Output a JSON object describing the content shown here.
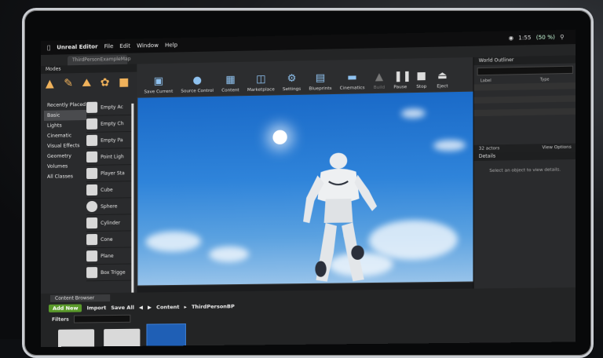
{
  "menubar": {
    "app": "Unreal Editor",
    "items": [
      "File",
      "Edit",
      "Window",
      "Help"
    ],
    "time": "1:55",
    "battery": "(50 %)"
  },
  "tab": {
    "label": "ThirdPersonExampleMap"
  },
  "modes": {
    "title": "Modes",
    "icons": [
      "place-icon",
      "paint-icon",
      "landscape-icon",
      "foliage-icon",
      "geometry-icon"
    ],
    "categories": [
      "Recently Placed",
      "Basic",
      "Lights",
      "Cinematic",
      "Visual Effects",
      "Geometry",
      "Volumes",
      "All Classes"
    ],
    "active_category": "Basic",
    "items": [
      "Empty Ac",
      "Empty Ch",
      "Empty Pa",
      "Point Ligh",
      "Player Sta",
      "Cube",
      "Sphere",
      "Cylinder",
      "Cone",
      "Plane",
      "Box Trigge"
    ]
  },
  "toolbar": {
    "buttons": [
      {
        "label": "Save Current",
        "icon": "save-icon"
      },
      {
        "label": "Source Control",
        "icon": "source-control-icon"
      },
      {
        "label": "Content",
        "icon": "content-icon"
      },
      {
        "label": "Marketplace",
        "icon": "marketplace-icon"
      },
      {
        "label": "Settings",
        "icon": "settings-icon"
      },
      {
        "label": "Blueprints",
        "icon": "blueprints-icon"
      },
      {
        "label": "Cinematics",
        "icon": "cinematics-icon"
      },
      {
        "label": "Build",
        "icon": "build-icon"
      },
      {
        "label": "Pause",
        "icon": "pause-icon"
      },
      {
        "label": "Stop",
        "icon": "stop-icon"
      },
      {
        "label": "Eject",
        "icon": "eject-icon"
      }
    ]
  },
  "outliner": {
    "title": "World Outliner",
    "columns": [
      "Label",
      "Type"
    ],
    "footer": "32 actors",
    "view_options": "View Options"
  },
  "details": {
    "title": "Details",
    "message": "Select an object to view details."
  },
  "content_browser": {
    "tab": "Content Browser",
    "add_new": "Add New",
    "import": "Import",
    "save_all": "Save All",
    "path": [
      "Content",
      "ThirdPersonBP"
    ],
    "filters": "Filters"
  },
  "colors": {
    "accent": "#5a9a2b",
    "sky": "#2f84da",
    "panel": "#2a2b2d"
  }
}
